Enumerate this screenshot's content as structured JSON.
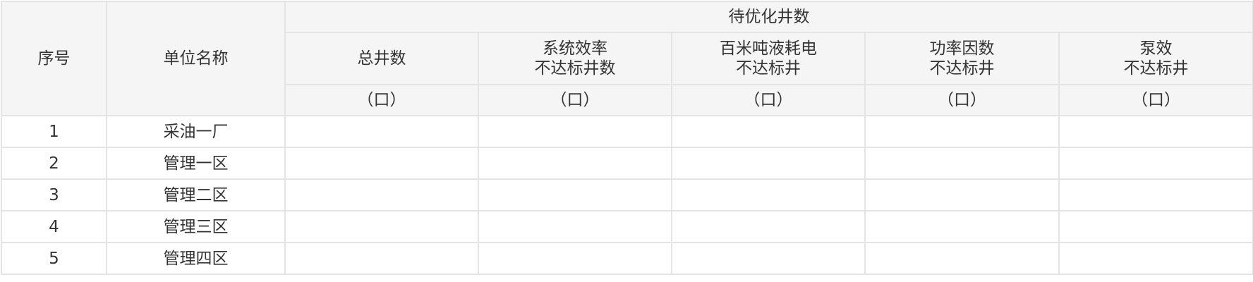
{
  "header": {
    "seq": "序号",
    "unit_name": "单位名称",
    "group_title": "待优化井数",
    "columns": [
      {
        "line1": "总井数",
        "line2": "",
        "unit": "（口）"
      },
      {
        "line1": "系统效率",
        "line2": "不达标井数",
        "unit": "（口）"
      },
      {
        "line1": "百米吨液耗电",
        "line2": "不达标井",
        "unit": "（口）"
      },
      {
        "line1": "功率因数",
        "line2": "不达标井",
        "unit": "（口）"
      },
      {
        "line1": "泵效",
        "line2": "不达标井",
        "unit": "（口）"
      }
    ]
  },
  "rows": [
    {
      "seq": "1",
      "name": "采油一厂",
      "values": [
        "",
        "",
        "",
        "",
        ""
      ]
    },
    {
      "seq": "2",
      "name": "管理一区",
      "values": [
        "",
        "",
        "",
        "",
        ""
      ]
    },
    {
      "seq": "3",
      "name": "管理二区",
      "values": [
        "",
        "",
        "",
        "",
        ""
      ]
    },
    {
      "seq": "4",
      "name": "管理三区",
      "values": [
        "",
        "",
        "",
        "",
        ""
      ]
    },
    {
      "seq": "5",
      "name": "管理四区",
      "values": [
        "",
        "",
        "",
        "",
        ""
      ]
    }
  ]
}
